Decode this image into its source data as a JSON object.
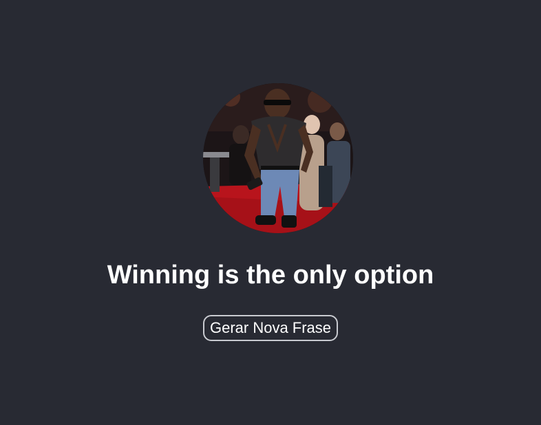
{
  "quote": {
    "text": "Winning is the only option"
  },
  "actions": {
    "generate_label": "Gerar Nova Frase"
  },
  "colors": {
    "background": "#282a33",
    "text": "#ffffff",
    "button_border": "#c9cbd1"
  }
}
